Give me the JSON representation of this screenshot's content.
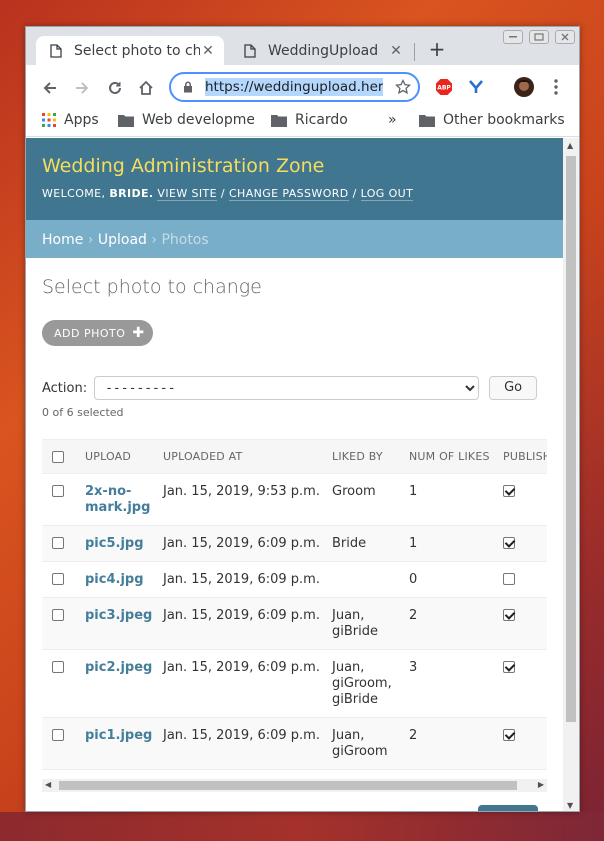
{
  "browser": {
    "tabs": [
      {
        "label": "Select photo to change",
        "active": true
      },
      {
        "label": "WeddingUpload",
        "active": false
      }
    ],
    "url": "https://weddingupload.herokuapp.com/admin/upload/photo/",
    "bookmarks": [
      "Apps",
      "Web development",
      "Ricardo",
      "»",
      "Other bookmarks"
    ]
  },
  "admin": {
    "site_name": "Wedding Administration Zone",
    "welcome": "WELCOME,",
    "user": "BRIDE.",
    "view_site": "VIEW SITE",
    "change_password": "CHANGE PASSWORD",
    "log_out": "LOG OUT",
    "sep": "/",
    "breadcrumbs": [
      "Home",
      "Upload",
      "Photos"
    ],
    "breadcrumb_sep": "›"
  },
  "page": {
    "title": "Select photo to change",
    "add_button": "ADD PHOTO",
    "action_label": "Action:",
    "action_selected": "---------",
    "go_label": "Go",
    "selection_count": "0 of 6 selected"
  },
  "table": {
    "columns": [
      "UPLOAD",
      "UPLOADED AT",
      "LIKED BY",
      "NUM OF LIKES",
      "PUBLISHED"
    ],
    "rows": [
      {
        "upload": "2x-no-mark.jpg",
        "uploaded_at": "Jan. 15, 2019, 9:53 p.m.",
        "liked_by": "Groom",
        "likes": "1",
        "published": true
      },
      {
        "upload": "pic5.jpg",
        "uploaded_at": "Jan. 15, 2019, 6:09 p.m.",
        "liked_by": "Bride",
        "likes": "1",
        "published": true
      },
      {
        "upload": "pic4.jpg",
        "uploaded_at": "Jan. 15, 2019, 6:09 p.m.",
        "liked_by": "",
        "likes": "0",
        "published": false
      },
      {
        "upload": "pic3.jpeg",
        "uploaded_at": "Jan. 15, 2019, 6:09 p.m.",
        "liked_by": "Juan, giBride",
        "likes": "2",
        "published": true
      },
      {
        "upload": "pic2.jpeg",
        "uploaded_at": "Jan. 15, 2019, 6:09 p.m.",
        "liked_by": "Juan, giGroom, giBride",
        "likes": "3",
        "published": true
      },
      {
        "upload": "pic1.jpeg",
        "uploaded_at": "Jan. 15, 2019, 6:09 p.m.",
        "liked_by": "Juan, giGroom",
        "likes": "2",
        "published": true
      }
    ]
  },
  "colors": {
    "header": "#417690",
    "site_name": "#f5dd5d",
    "breadcrumbs": "#79aec8",
    "link": "#447e9b"
  }
}
